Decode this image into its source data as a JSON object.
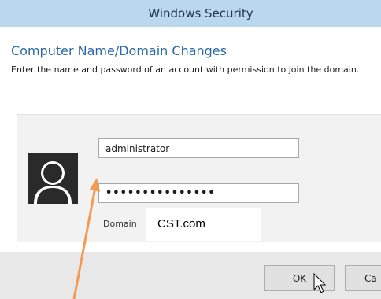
{
  "window": {
    "title": "Windows Security"
  },
  "dialog": {
    "heading": "Computer Name/Domain Changes",
    "instructions": "Enter the name and password of an account with permission to join the domain."
  },
  "credentials": {
    "username_value": "administrator",
    "password_value": "•••••••••••••••",
    "domain_label": "Domain",
    "domain_value": "CST.com"
  },
  "buttons": {
    "ok_label": "OK",
    "cancel_label": "Ca"
  },
  "icons": {
    "avatar": "user-silhouette-icon",
    "pointer": "mouse-cursor-icon",
    "annotation": "arrow-icon"
  },
  "colors": {
    "titlebar": "#b9d8ee",
    "heading": "#2b6aa6",
    "annotation_arrow": "#f39a55"
  }
}
